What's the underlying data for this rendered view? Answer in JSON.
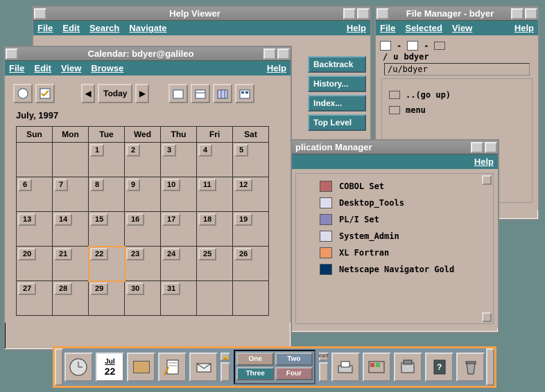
{
  "help_viewer": {
    "title": "Help Viewer",
    "menu": {
      "file": "File",
      "edit": "Edit",
      "search": "Search",
      "navigate": "Navigate",
      "help": "Help"
    },
    "buttons": {
      "backtrack": "Backtrack",
      "history": "History...",
      "index": "Index...",
      "top_level": "Top Level"
    }
  },
  "file_manager": {
    "title": "File Manager - bdyer",
    "menu": {
      "file": "File",
      "selected": "Selected",
      "view": "View",
      "help": "Help"
    },
    "breadcrumb": [
      "/",
      "u",
      "bdyer"
    ],
    "path": "/u/bdyer",
    "items": {
      "go_up": "..(go up)",
      "menu": "menu"
    }
  },
  "calendar": {
    "title": "Calendar: bdyer@galileo",
    "menu": {
      "file": "File",
      "edit": "Edit",
      "view": "View",
      "browse": "Browse",
      "help": "Help"
    },
    "month_label": "July, 1997",
    "today_label": "Today",
    "weekdays": [
      "Sun",
      "Mon",
      "Tue",
      "Wed",
      "Thu",
      "Fri",
      "Sat"
    ],
    "weeks": [
      [
        "",
        "",
        "1",
        "2",
        "3",
        "4",
        "5"
      ],
      [
        "6",
        "7",
        "8",
        "9",
        "10",
        "11",
        "12"
      ],
      [
        "13",
        "14",
        "15",
        "16",
        "17",
        "18",
        "19"
      ],
      [
        "20",
        "21",
        "22",
        "23",
        "24",
        "25",
        "26"
      ],
      [
        "27",
        "28",
        "29",
        "30",
        "31",
        "",
        ""
      ]
    ],
    "today_day": "22"
  },
  "app_manager": {
    "title": "plication Manager",
    "menu": {
      "help": "Help"
    },
    "items": [
      "COBOL Set",
      "Desktop_Tools",
      "PL/I Set",
      "System_Admin",
      "XL Fortran",
      "Netscape Navigator Gold"
    ]
  },
  "frontpanel": {
    "date_month": "Jul",
    "date_day": "22",
    "workspaces": {
      "one": "One",
      "two": "Two",
      "three": "Three",
      "four": "Four"
    }
  }
}
